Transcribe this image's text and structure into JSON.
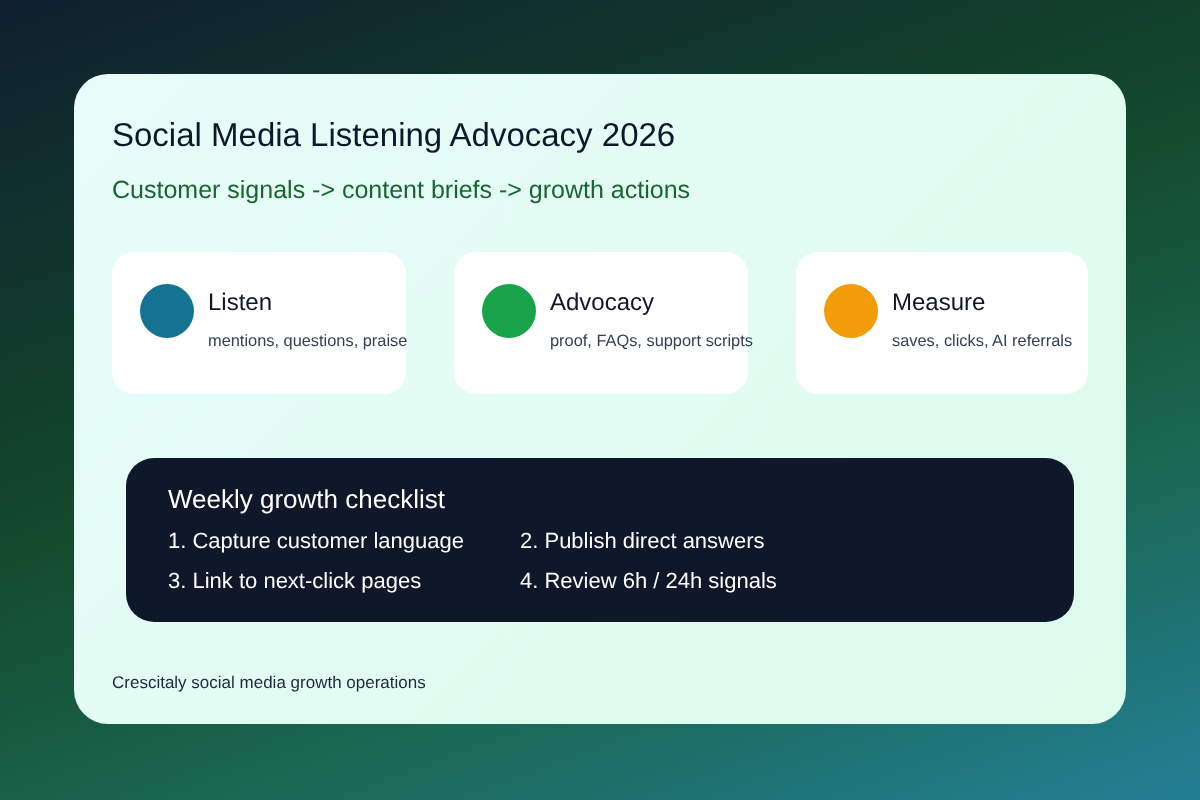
{
  "title": "Social Media Listening Advocacy 2026",
  "subtitle": "Customer signals -> content briefs -> growth actions",
  "pillars": [
    {
      "name": "Listen",
      "detail": "mentions, questions, praise",
      "color": "#137391"
    },
    {
      "name": "Advocacy",
      "detail": "proof, FAQs, support scripts",
      "color": "#19a34a"
    },
    {
      "name": "Measure",
      "detail": "saves, clicks, AI referrals",
      "color": "#f39c0b"
    }
  ],
  "checklist": {
    "title": "Weekly growth checklist",
    "items": [
      "1. Capture customer language",
      "2. Publish direct answers",
      "3. Link to next-click pages",
      "4. Review 6h / 24h signals"
    ]
  },
  "footer": "Crescitaly social media growth operations"
}
